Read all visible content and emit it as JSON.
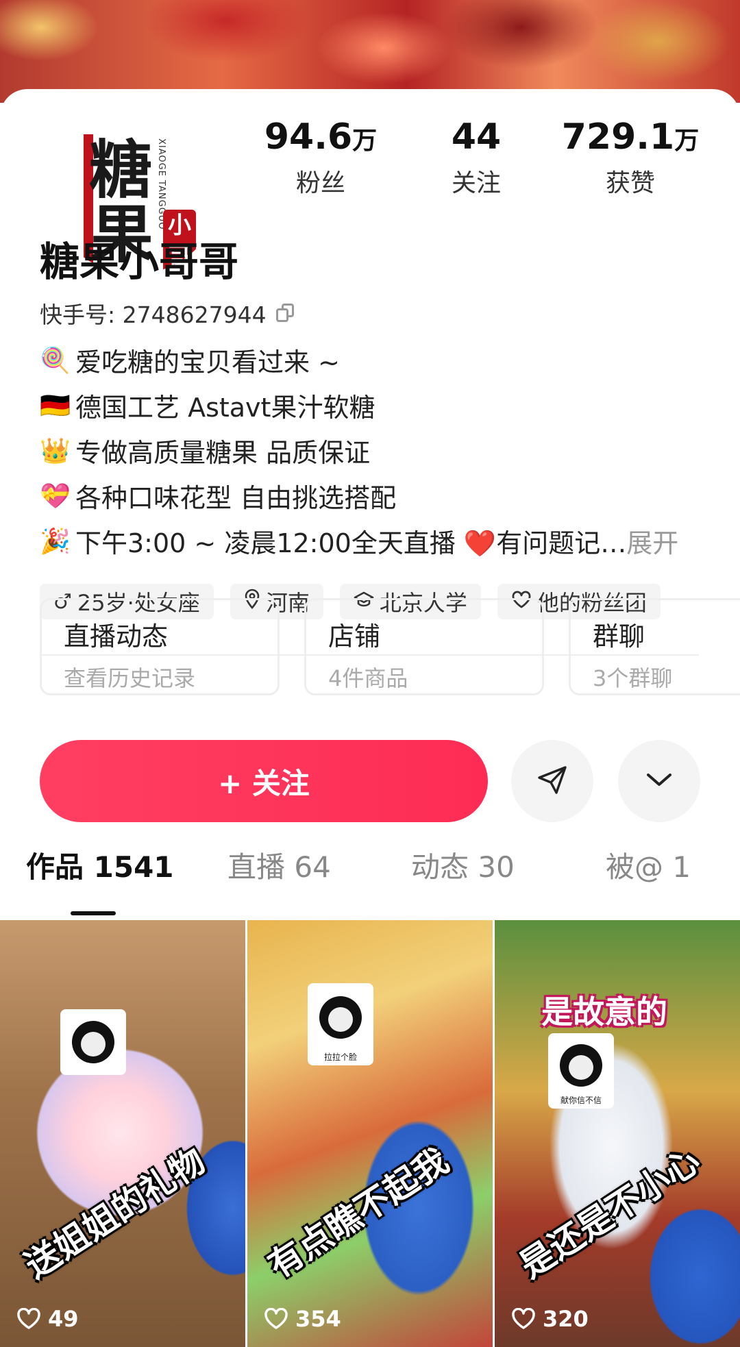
{
  "profile": {
    "avatar_logo": {
      "big_1": "糖",
      "big_2": "果",
      "small": "小哥",
      "pinyin": "XIAOGE TANGGUO"
    },
    "nickname": "糖果小哥哥",
    "kuaishou_id": "快手号: 2748627944",
    "stats": [
      {
        "num": "94.6",
        "unit": "万",
        "label": "粉丝"
      },
      {
        "num": "44",
        "unit": "",
        "label": "关注"
      },
      {
        "num": "729.1",
        "unit": "万",
        "label": "获赞"
      }
    ],
    "bio": [
      {
        "emoji": "🍭",
        "text": "爱吃糖的宝贝看过来 ~"
      },
      {
        "emoji": "🇩🇪",
        "text": "德国工艺  Astavt果汁软糖"
      },
      {
        "emoji": "👑",
        "text": "专做高质量糖果  品质保证"
      },
      {
        "emoji": "💝",
        "text": "各种口味花型 自由挑选搭配"
      },
      {
        "emoji": "🎉",
        "text": "下午3:00 ~ 凌晨12:00全天直播 ❤️有问题记…",
        "expand": "展开"
      }
    ],
    "tags": [
      {
        "icon": "male-icon",
        "glyph": "♂",
        "label": "25岁·处女座"
      },
      {
        "icon": "location-pin-icon",
        "glyph": "⚲",
        "label": "河南"
      },
      {
        "icon": "graduation-cap-icon",
        "glyph": "🎓",
        "label": "北京大学"
      },
      {
        "icon": "heart-outline-icon",
        "glyph": "♡",
        "label": "他的粉丝团"
      }
    ]
  },
  "entries": [
    {
      "title": "直播动态",
      "sub": "查看历史记录"
    },
    {
      "title": "店铺",
      "sub": "4件商品"
    },
    {
      "title": "群聊",
      "sub": "3个群聊"
    }
  ],
  "actions": {
    "follow_label": "+ 关注",
    "share_icon": "send-icon",
    "more_icon": "chevron-down-icon",
    "accent": "#fe2c55"
  },
  "tabs": [
    {
      "label": "作品 1541",
      "active": true
    },
    {
      "label": "直播 64",
      "active": false
    },
    {
      "label": "动态 30",
      "active": false
    },
    {
      "label": "被@ 1",
      "active": false
    }
  ],
  "videos": [
    {
      "caption": "送姐姐的礼物",
      "top_caption": "",
      "sticker_text": "",
      "likes": "49"
    },
    {
      "caption": "有点瞧不起我",
      "top_caption": "",
      "sticker_text": "拉拉个脸",
      "likes": "354"
    },
    {
      "caption": "是还是不小心",
      "top_caption": "是故意的",
      "sticker_text": "献你信不信",
      "likes": "320"
    }
  ]
}
